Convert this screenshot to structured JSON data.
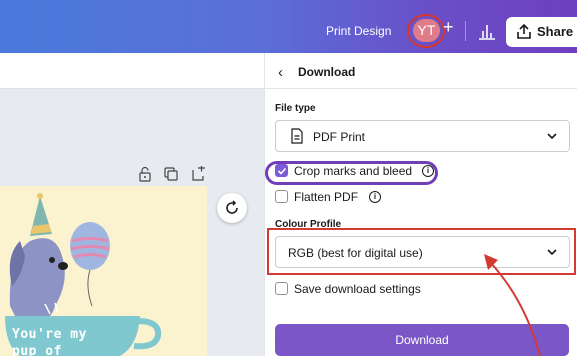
{
  "header": {
    "design_name": "Print Design",
    "avatar_initials": "YT",
    "plus": "+",
    "share_label": "Share",
    "share_icon": "share-upload-icon",
    "chart_icon": "insights-chart-icon"
  },
  "editor": {
    "card_text_line1": "You're my",
    "card_text_line2": "pup of",
    "controls": [
      "lock-icon",
      "duplicate-icon",
      "add-page-icon"
    ],
    "refresh_icon": "refresh-icon"
  },
  "download_panel": {
    "back_icon": "chevron-left-icon",
    "title": "Download",
    "file_type_label": "File type",
    "file_type_value": "PDF Print",
    "crop_marks_label": "Crop marks and bleed",
    "crop_marks_checked": true,
    "flatten_label": "Flatten PDF",
    "flatten_checked": false,
    "colour_profile_label": "Colour Profile",
    "colour_profile_value": "RGB (best for digital use)",
    "save_settings_label": "Save download settings",
    "save_settings_checked": false,
    "download_button": "Download",
    "info_glyph": "i"
  },
  "colors": {
    "accent_purple": "#7b56c7",
    "highlight_purple": "#6f3fb8",
    "highlight_red": "#d23a33"
  }
}
